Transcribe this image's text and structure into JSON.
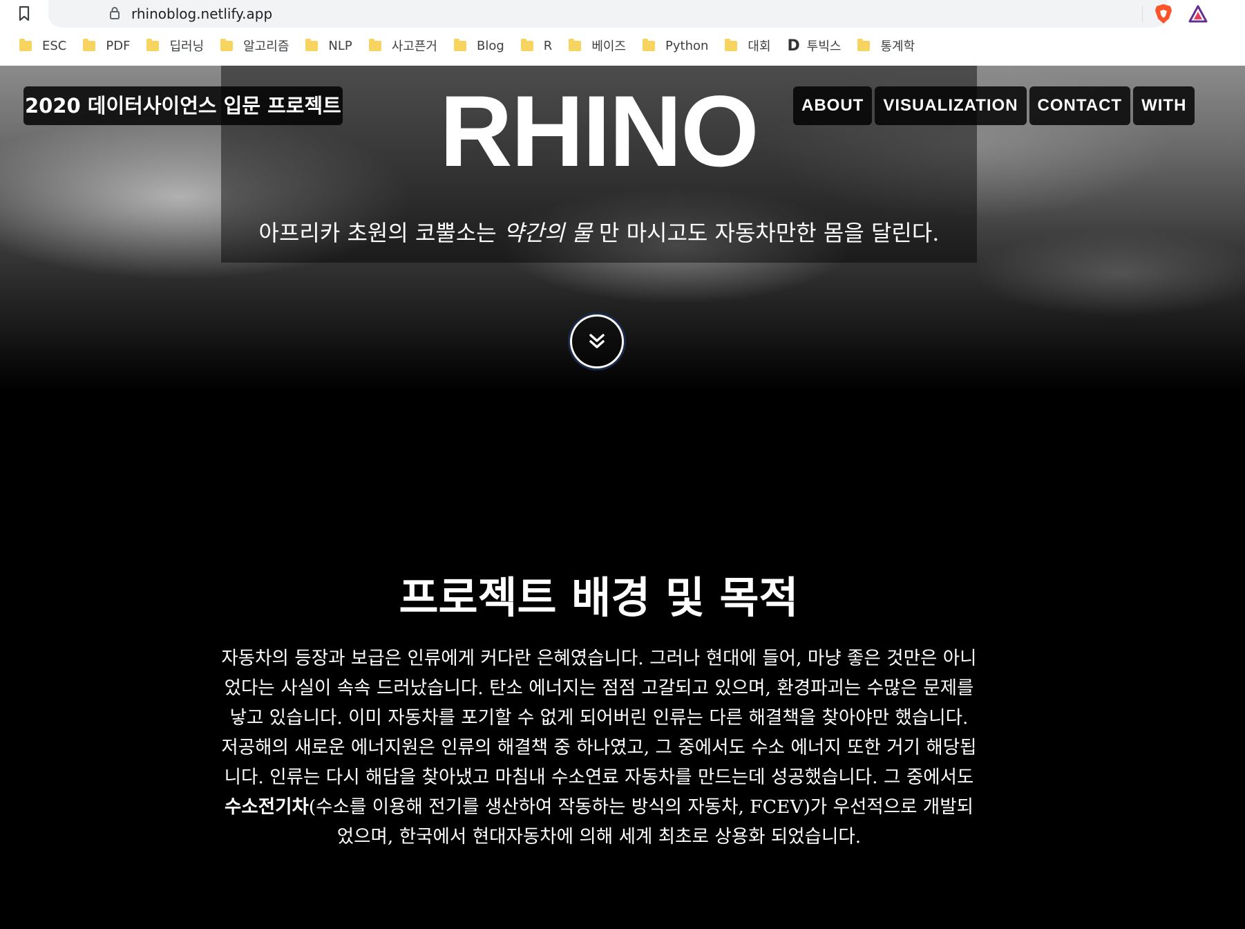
{
  "browser": {
    "url": "rhinoblog.netlify.app",
    "bookmarks": [
      {
        "label": "ESC",
        "icon": "folder-icon"
      },
      {
        "label": "PDF",
        "icon": "folder-icon"
      },
      {
        "label": "딥러닝",
        "icon": "folder-icon"
      },
      {
        "label": "알고리즘",
        "icon": "folder-icon"
      },
      {
        "label": "NLP",
        "icon": "folder-icon"
      },
      {
        "label": "사고픈거",
        "icon": "folder-icon"
      },
      {
        "label": "Blog",
        "icon": "folder-icon"
      },
      {
        "label": "R",
        "icon": "folder-icon"
      },
      {
        "label": "베이즈",
        "icon": "folder-icon"
      },
      {
        "label": "Python",
        "icon": "folder-icon"
      },
      {
        "label": "대회",
        "icon": "folder-icon"
      },
      {
        "label": "투빅스",
        "icon": "d-logo-icon",
        "logo_letter": "D"
      },
      {
        "label": "통계학",
        "icon": "folder-icon"
      }
    ],
    "colors": {
      "folder": "#f7d460",
      "brave": "#fb542b",
      "rewards": "#662d91"
    }
  },
  "site": {
    "title": "2020 데이터사이언스 입문 프로젝트",
    "hero_title": "RHINO",
    "nav": [
      "ABOUT",
      "VISUALIZATION",
      "CONTACT",
      "WITH"
    ],
    "subtitle_before": "아프리카 초원의 코뿔소는 ",
    "subtitle_em": "약간의 물",
    "subtitle_after": " 만 마시고도 자동차만한 몸을 달린다."
  },
  "section": {
    "title": "프로젝트 배경 및 목적",
    "body_before": "자동차의 등장과 보급은 인류에게 커다란 은혜였습니다. 그러나 현대에 들어, 마냥 좋은 것만은 아니었다는 사실이 속속 드러났습니다. 탄소 에너지는 점점 고갈되고 있으며, 환경파괴는 수많은 문제를 낳고 있습니다. 이미 자동차를 포기할 수 없게 되어버린 인류는 다른 해결책을 찾아야만 했습니다. 저공해의 새로운 에너지원은 인류의 해결책 중 하나였고, 그 중에서도 수소 에너지 또한 거기 해당됩니다. 인류는 다시 해답을 찾아냈고 마침내 수소연료 자동차를 만드는데 성공했습니다. 그 중에서도 ",
    "body_bold": "수소전기차",
    "body_after": "(수소를 이용해 전기를 생산하여 작동하는 방식의 자동차, FCEV)가 우선적으로 개발되었으며, 한국에서 현대자동차에 의해 세계 최초로 상용화 되었습니다."
  }
}
